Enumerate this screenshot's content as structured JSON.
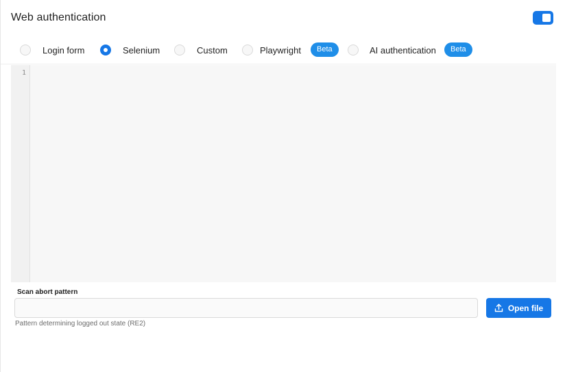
{
  "header": {
    "title": "Web authentication",
    "toggle_on": true
  },
  "auth_options": [
    {
      "label": "Login form",
      "selected": false
    },
    {
      "label": "Selenium",
      "selected": true
    },
    {
      "label": "Custom",
      "selected": false
    },
    {
      "label": "Playwright",
      "selected": false,
      "badge": "Beta"
    },
    {
      "label": "AI authentication",
      "selected": false,
      "badge": "Beta"
    }
  ],
  "editor": {
    "line_number": "1",
    "content": ""
  },
  "abort_pattern": {
    "label": "Scan abort pattern",
    "value": "",
    "placeholder": "",
    "help": "Pattern determining logged out state (RE2)"
  },
  "open_file": {
    "label": "Open file",
    "icon": "upload-icon"
  },
  "colors": {
    "accent": "#1677e6",
    "badge": "#1f8ee8"
  }
}
